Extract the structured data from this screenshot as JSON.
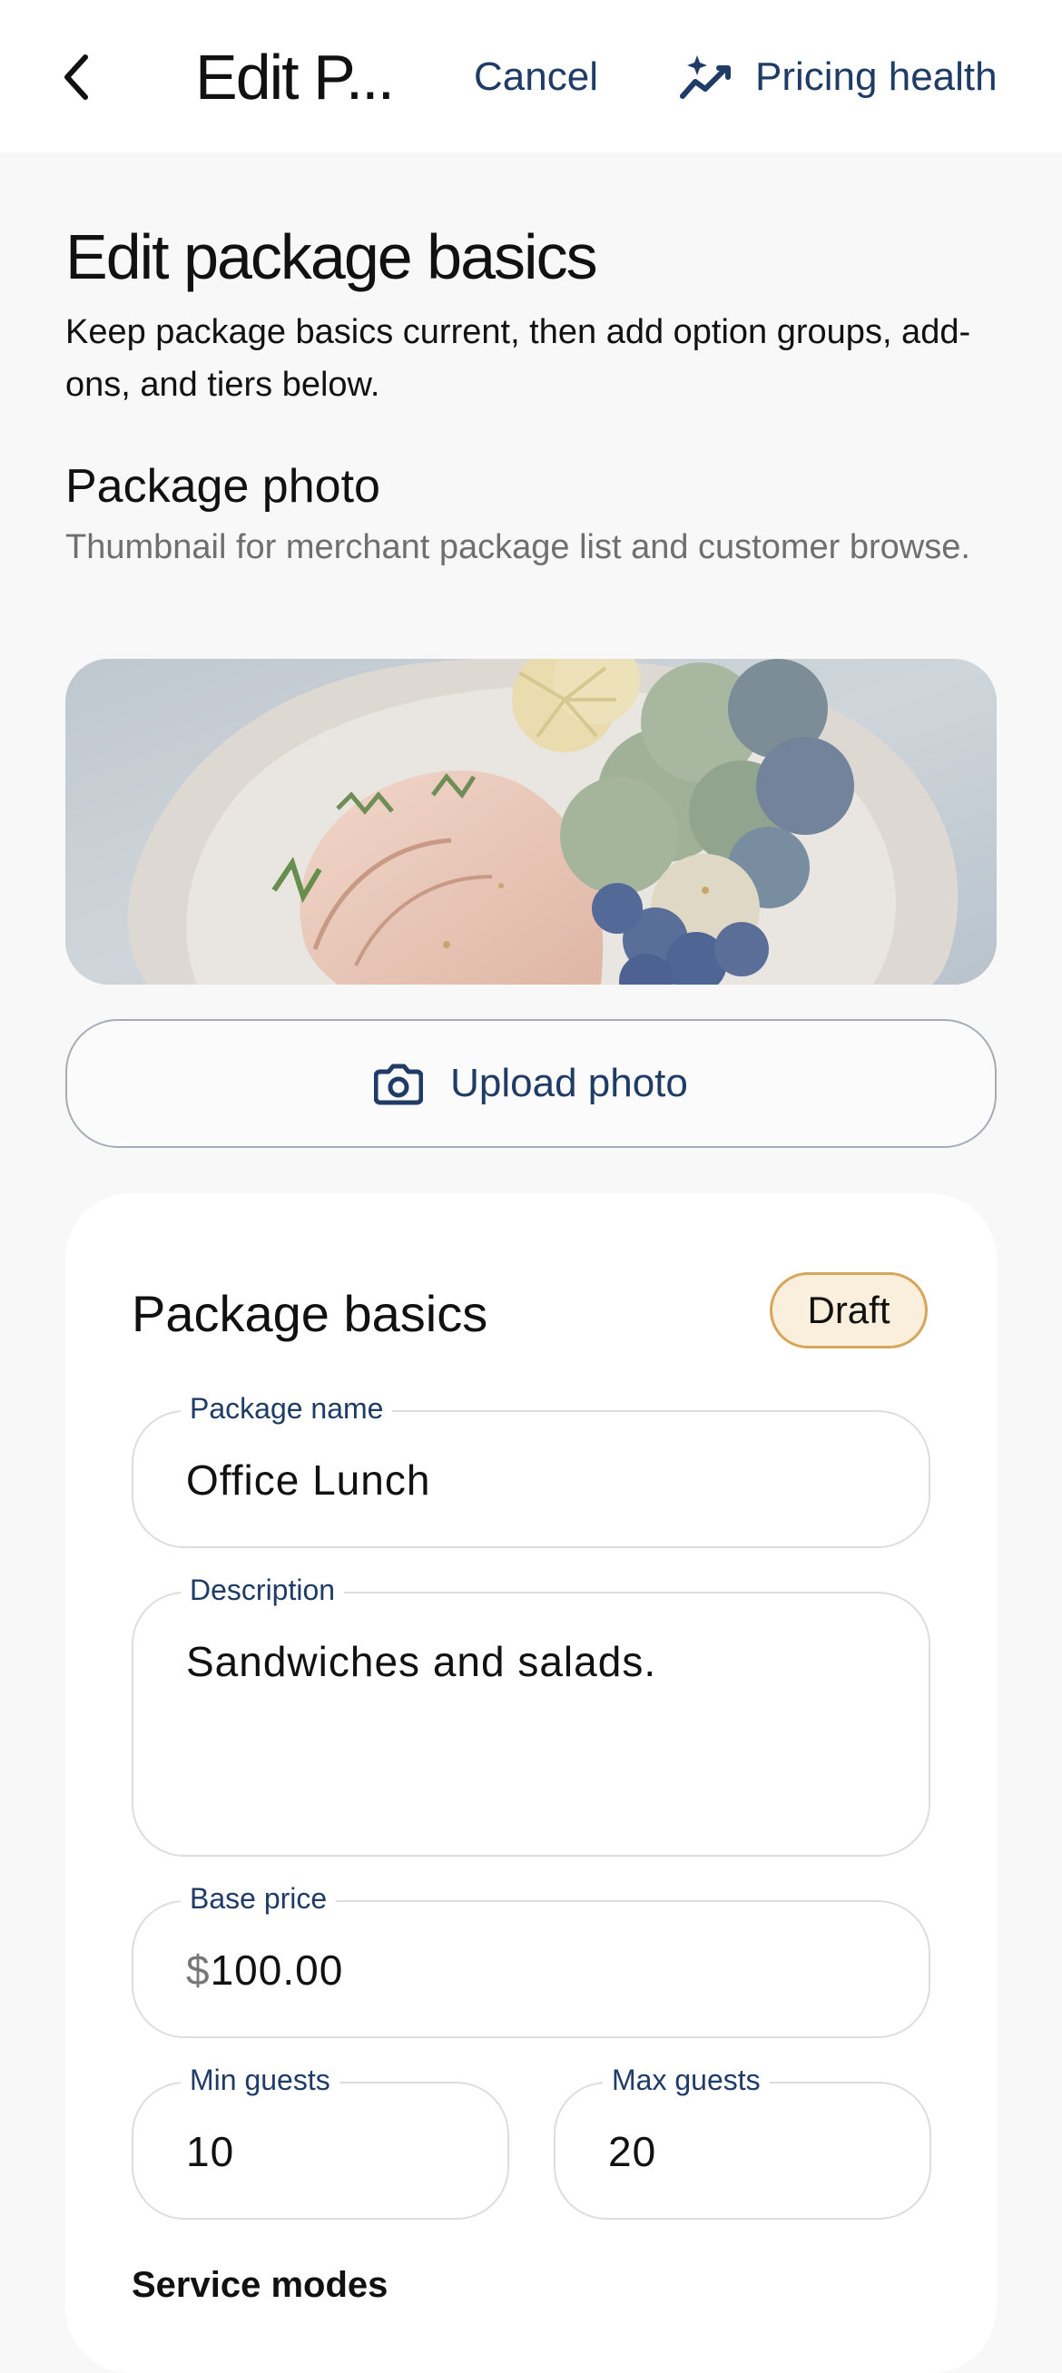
{
  "header": {
    "back_icon": "chevron-left-icon",
    "title": "Edit P...",
    "cancel_label": "Cancel",
    "pricing_health_icon": "sparkle-trend-icon",
    "pricing_health_label": "Pricing health"
  },
  "page": {
    "heading": "Edit package basics",
    "subtitle": "Keep package basics current, then add option groups, add-ons, and tiers below."
  },
  "photo": {
    "heading": "Package photo",
    "subtitle": "Thumbnail for merchant package list and customer browse.",
    "image_description": "food-plate-photo",
    "upload_icon": "camera-icon",
    "upload_label": "Upload photo"
  },
  "basics": {
    "title": "Package basics",
    "status_badge": "Draft",
    "package_name": {
      "label": "Package name",
      "value": "Office Lunch"
    },
    "description": {
      "label": "Description",
      "value": "Sandwiches and salads."
    },
    "base_price": {
      "label": "Base price",
      "currency": "$",
      "value": "100.00"
    },
    "min_guests": {
      "label": "Min guests",
      "value": "10"
    },
    "max_guests": {
      "label": "Max guests",
      "value": "20"
    },
    "service_modes_label": "Service modes"
  },
  "colors": {
    "accent": "#1f3c67",
    "background": "#f8f8f8",
    "draft_badge_fill": "#faeedc",
    "draft_badge_border": "#d8a65a"
  }
}
